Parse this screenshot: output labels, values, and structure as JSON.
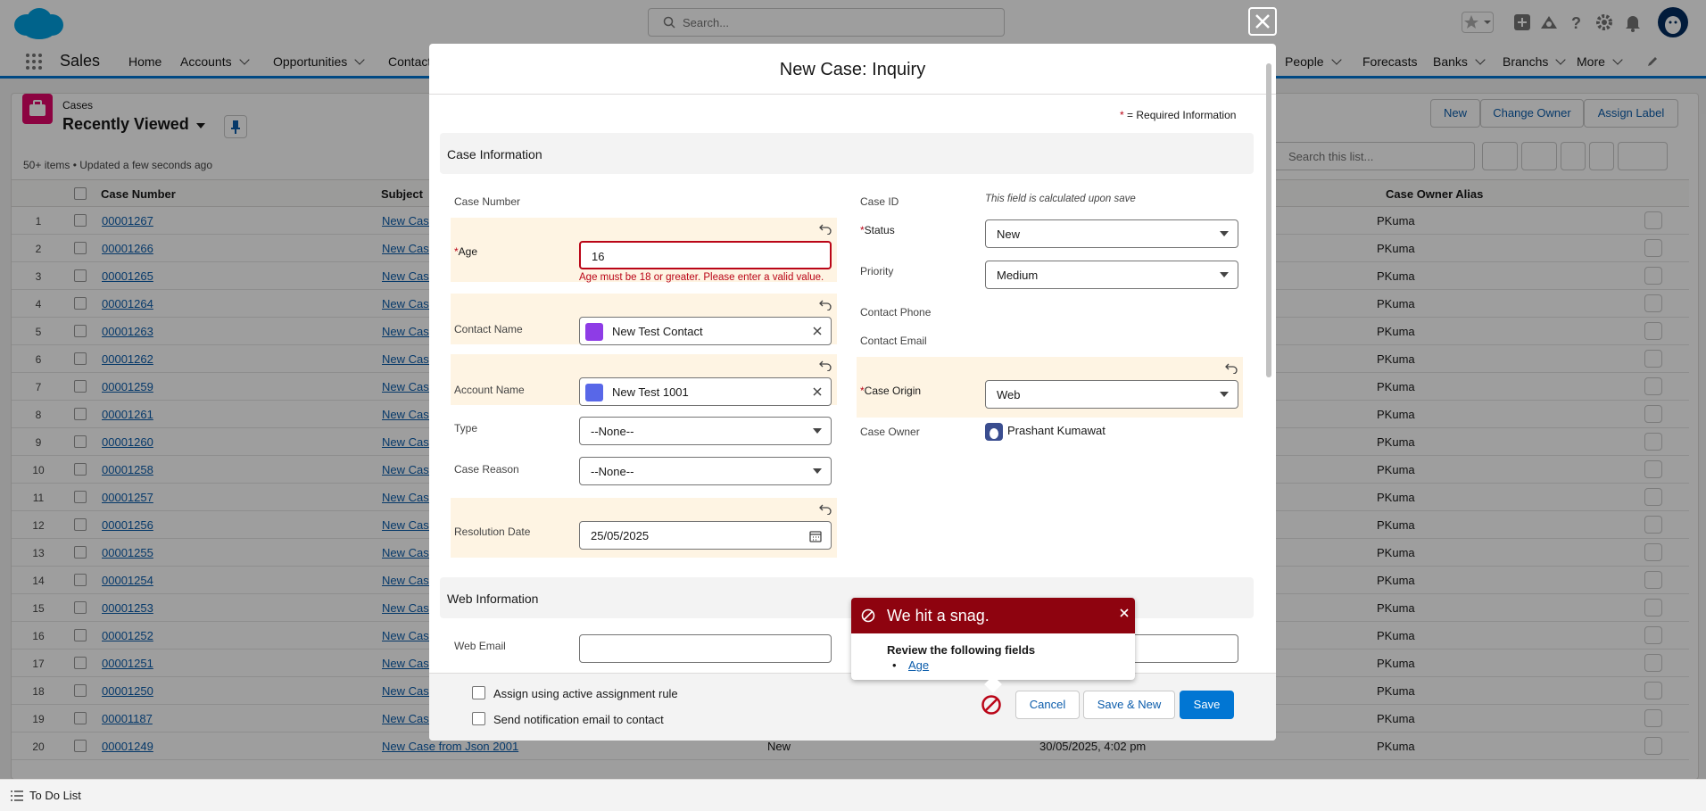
{
  "header": {
    "search_placeholder": "Search..."
  },
  "nav": {
    "app_name": "Sales",
    "items": [
      {
        "label": "Home",
        "chevron": false
      },
      {
        "label": "Accounts",
        "chevron": true
      },
      {
        "label": "Opportunities",
        "chevron": true
      },
      {
        "label": "Contacts",
        "chevron": false
      },
      {
        "label": "People",
        "chevron": true
      },
      {
        "label": "Forecasts",
        "chevron": false
      },
      {
        "label": "Banks",
        "chevron": true
      },
      {
        "label": "Branchs",
        "chevron": true
      },
      {
        "label": "More",
        "chevron": true
      }
    ]
  },
  "list": {
    "object": "Cases",
    "view_name": "Recently Viewed",
    "status": "50+ items • Updated a few seconds ago",
    "buttons": {
      "new": "New",
      "change_owner": "Change Owner",
      "assign_label": "Assign Label"
    },
    "search_placeholder": "Search this list...",
    "columns": {
      "case_number": "Case Number",
      "subject": "Subject",
      "owner_alias": "Case Owner Alias"
    },
    "rows": [
      {
        "n": "1",
        "case": "00001267",
        "subject": "New Case",
        "status": "",
        "date": "",
        "owner": "PKuma"
      },
      {
        "n": "2",
        "case": "00001266",
        "subject": "New Case",
        "status": "",
        "date": "",
        "owner": "PKuma"
      },
      {
        "n": "3",
        "case": "00001265",
        "subject": "New Case",
        "status": "",
        "date": "",
        "owner": "PKuma"
      },
      {
        "n": "4",
        "case": "00001264",
        "subject": "New Case",
        "status": "",
        "date": "",
        "owner": "PKuma"
      },
      {
        "n": "5",
        "case": "00001263",
        "subject": "New Case",
        "status": "",
        "date": "",
        "owner": "PKuma"
      },
      {
        "n": "6",
        "case": "00001262",
        "subject": "New Case",
        "status": "",
        "date": "",
        "owner": "PKuma"
      },
      {
        "n": "7",
        "case": "00001259",
        "subject": "New Case",
        "status": "",
        "date": "",
        "owner": "PKuma"
      },
      {
        "n": "8",
        "case": "00001261",
        "subject": "New Case",
        "status": "",
        "date": "",
        "owner": "PKuma"
      },
      {
        "n": "9",
        "case": "00001260",
        "subject": "New Case",
        "status": "",
        "date": "",
        "owner": "PKuma"
      },
      {
        "n": "10",
        "case": "00001258",
        "subject": "New Case",
        "status": "",
        "date": "",
        "owner": "PKuma"
      },
      {
        "n": "11",
        "case": "00001257",
        "subject": "New Case",
        "status": "",
        "date": "",
        "owner": "PKuma"
      },
      {
        "n": "12",
        "case": "00001256",
        "subject": "New Case",
        "status": "",
        "date": "",
        "owner": "PKuma"
      },
      {
        "n": "13",
        "case": "00001255",
        "subject": "New Case",
        "status": "",
        "date": "",
        "owner": "PKuma"
      },
      {
        "n": "14",
        "case": "00001254",
        "subject": "New Case",
        "status": "",
        "date": "",
        "owner": "PKuma"
      },
      {
        "n": "15",
        "case": "00001253",
        "subject": "New Case",
        "status": "",
        "date": "",
        "owner": "PKuma"
      },
      {
        "n": "16",
        "case": "00001252",
        "subject": "New Case",
        "status": "",
        "date": "",
        "owner": "PKuma"
      },
      {
        "n": "17",
        "case": "00001251",
        "subject": "New Case",
        "status": "",
        "date": "",
        "owner": "PKuma"
      },
      {
        "n": "18",
        "case": "00001250",
        "subject": "New Case",
        "status": "",
        "date": "",
        "owner": "PKuma"
      },
      {
        "n": "19",
        "case": "00001187",
        "subject": "New Case",
        "status": "",
        "date": "",
        "owner": "PKuma"
      },
      {
        "n": "20",
        "case": "00001249",
        "subject": "New Case from Json 2001",
        "status": "New",
        "date": "30/05/2025, 4:02 pm",
        "owner": "PKuma"
      }
    ]
  },
  "todo": {
    "label": "To Do List"
  },
  "modal": {
    "title": "New Case: Inquiry",
    "required_note": "= Required Information",
    "required_mark": "*",
    "sections": {
      "case_info": "Case Information",
      "web_info": "Web Information"
    },
    "fields": {
      "case_number_label": "Case Number",
      "age_label": "Age",
      "age_value": "16",
      "age_error": "Age must be 18 or greater. Please enter a valid value.",
      "contact_name_label": "Contact Name",
      "contact_name_value": "New Test Contact",
      "account_name_label": "Account Name",
      "account_name_value": "New Test 1001",
      "type_label": "Type",
      "type_value": "--None--",
      "case_reason_label": "Case Reason",
      "case_reason_value": "--None--",
      "resolution_date_label": "Resolution Date",
      "resolution_date_value": "25/05/2025",
      "case_id_label": "Case ID",
      "case_id_value": "This field is calculated upon save",
      "status_label": "Status",
      "status_value": "New",
      "priority_label": "Priority",
      "priority_value": "Medium",
      "contact_phone_label": "Contact Phone",
      "contact_email_label": "Contact Email",
      "case_origin_label": "Case Origin",
      "case_origin_value": "Web",
      "case_owner_label": "Case Owner",
      "case_owner_value": "Prashant Kumawat",
      "web_email_label": "Web Email"
    },
    "footer": {
      "assign_rule": "Assign using active assignment rule",
      "send_notification": "Send notification email to contact",
      "cancel": "Cancel",
      "save_new": "Save & New",
      "save": "Save"
    },
    "error": {
      "title": "We hit a snag.",
      "review": "Review the following fields",
      "fields": [
        "Age"
      ]
    }
  },
  "colors": {
    "brand": "#0176d3",
    "error": "#ba0517",
    "snag_header": "#8e030f",
    "highlight": "#fef4e3"
  }
}
